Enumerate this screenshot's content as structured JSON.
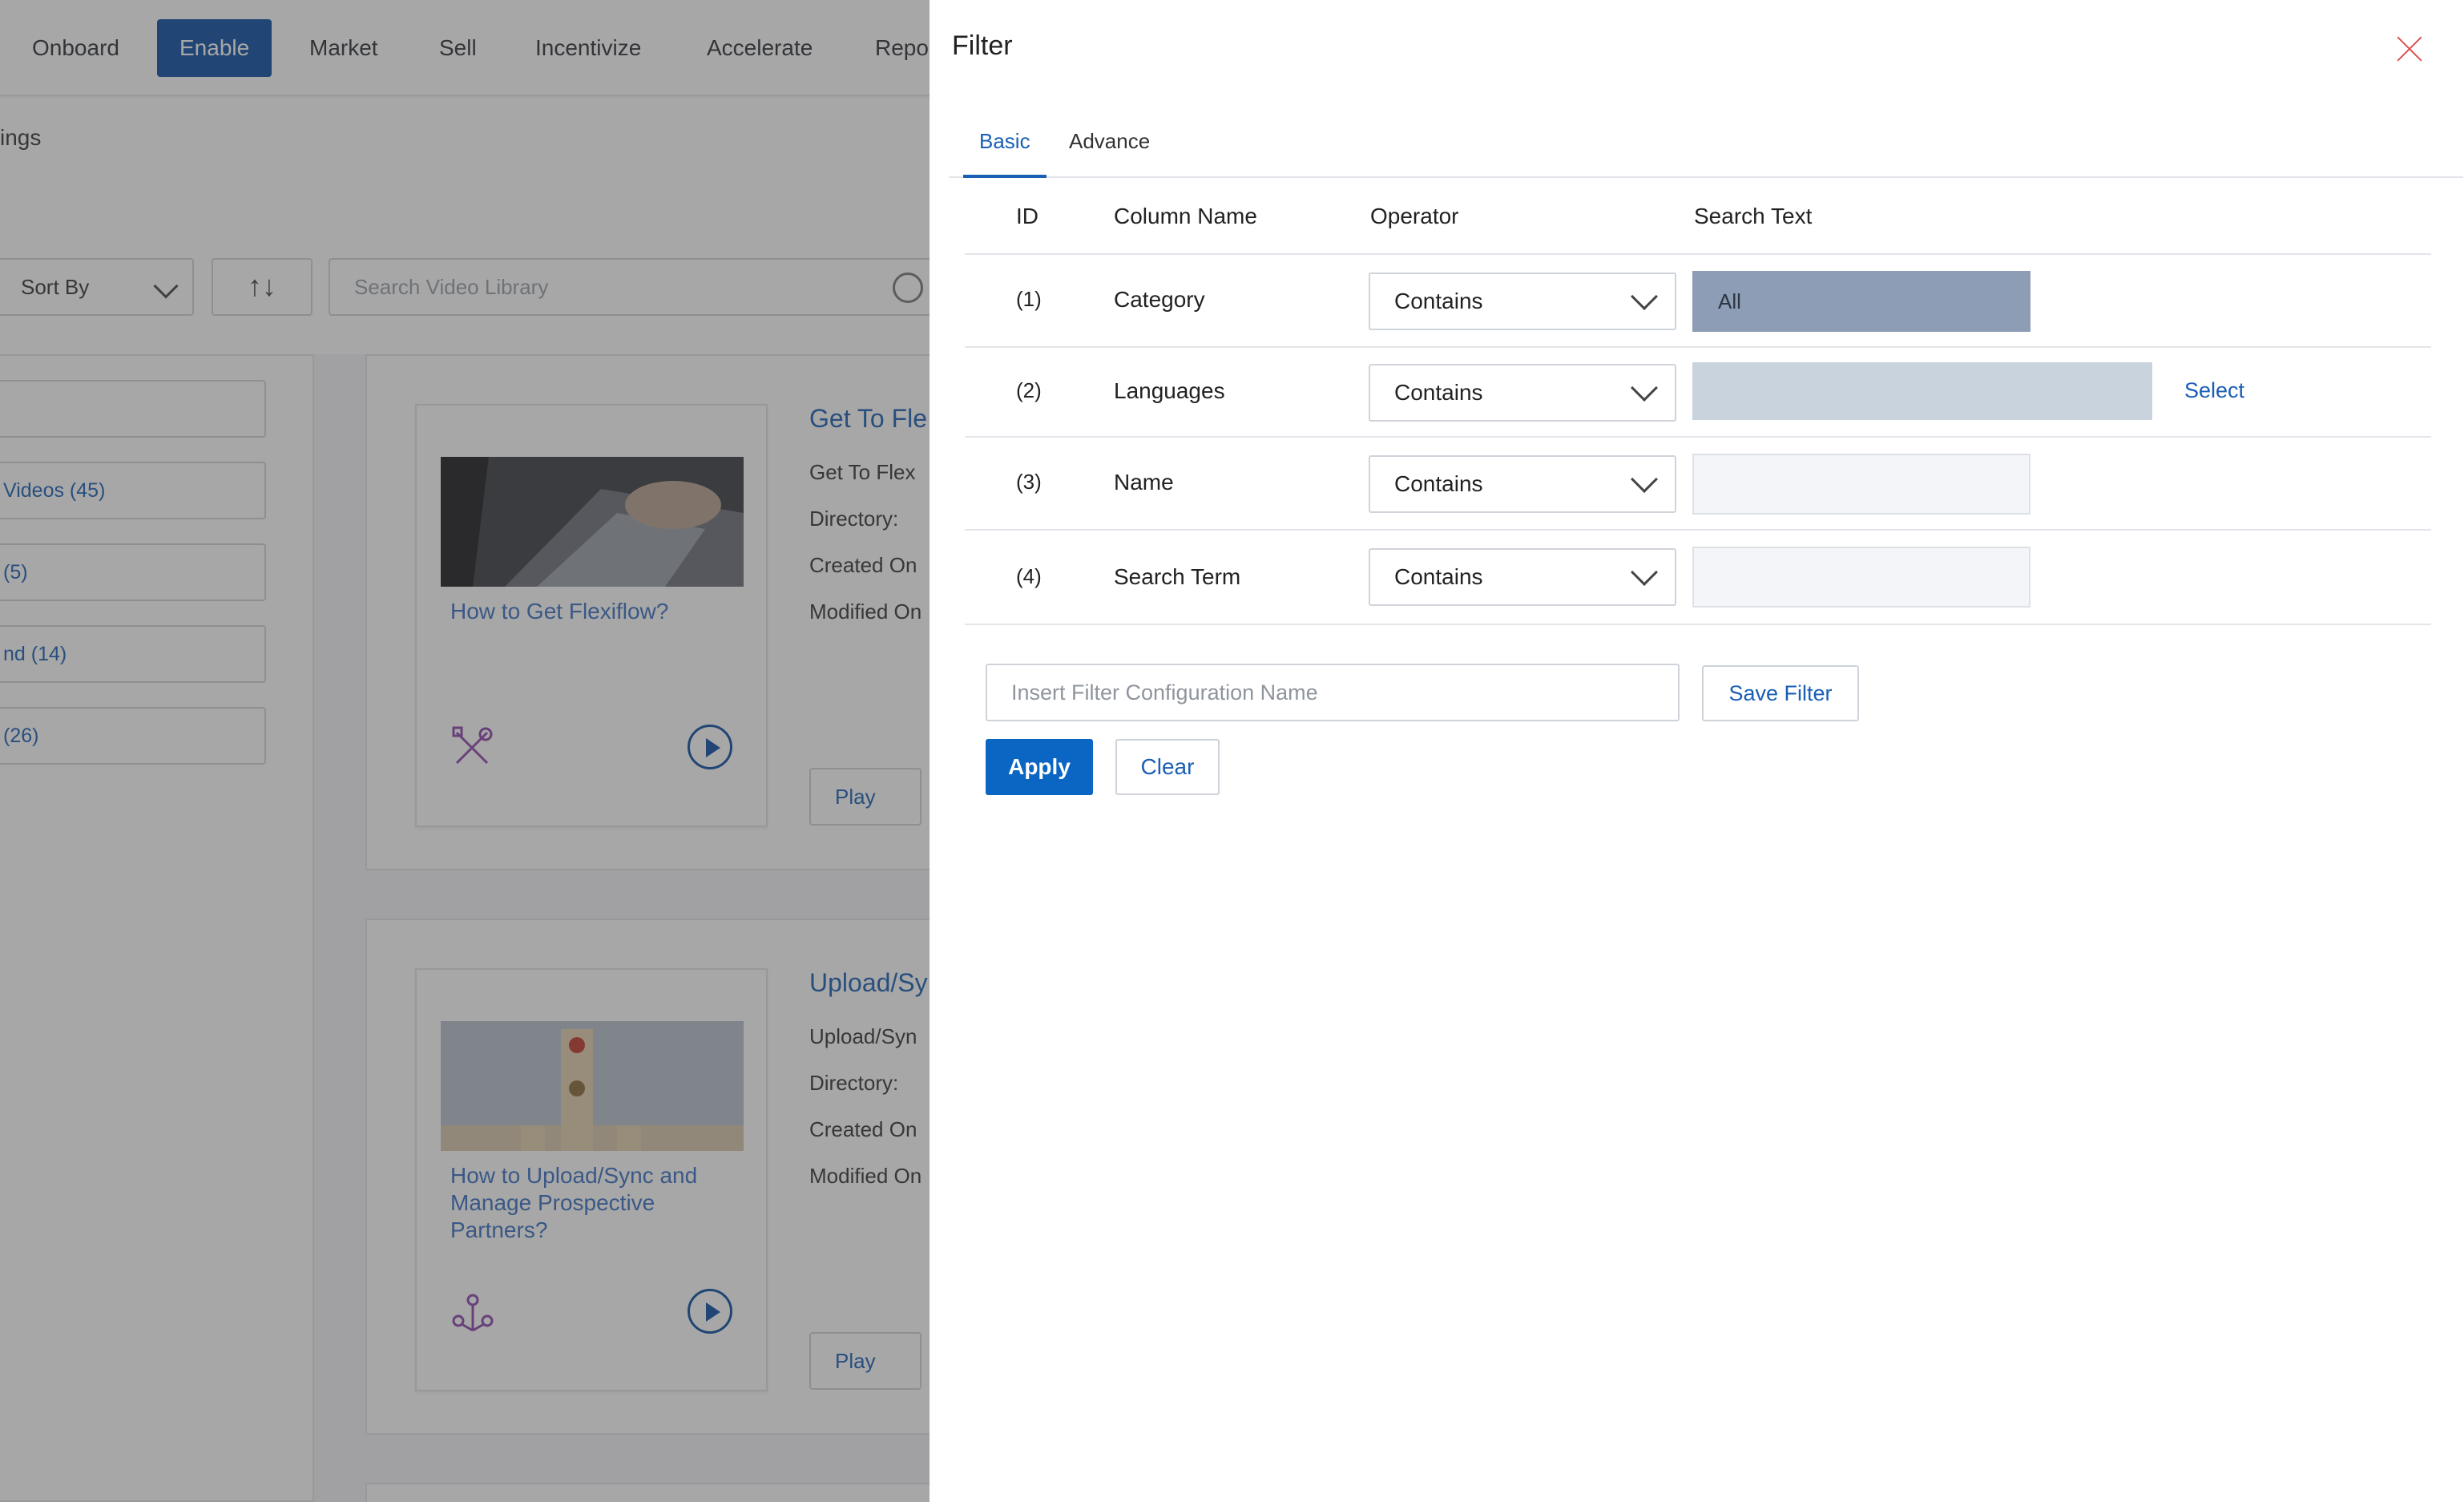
{
  "nav": {
    "items": [
      "Onboard",
      "Enable",
      "Market",
      "Sell",
      "Incentivize",
      "Accelerate",
      "Repo"
    ],
    "active": "Enable"
  },
  "subnav": {
    "label": "ings"
  },
  "toolbar": {
    "sort_label": "Sort By",
    "sort_dir_icon": "↑↓",
    "search_placeholder": "Search Video Library"
  },
  "categories": [
    {
      "label": "Videos (45)"
    },
    {
      "label": "(5)"
    },
    {
      "label": "nd (14)"
    },
    {
      "label": "(26)"
    }
  ],
  "cards": [
    {
      "thumb_title": "How to Get Flexiflow?",
      "detail_title": "Get To Fle",
      "lines": [
        "Get To Flex",
        "Directory:",
        "Created On",
        "Modified On"
      ],
      "play_label": "Play"
    },
    {
      "thumb_title": "How to Upload/Sync and Manage Prospective Partners?",
      "detail_title": "Upload/Sy",
      "lines": [
        "Upload/Syn",
        "Directory:",
        "Created On",
        "Modified On"
      ],
      "play_label": "Play"
    }
  ],
  "filter": {
    "title": "Filter",
    "tabs": [
      "Basic",
      "Advance"
    ],
    "active_tab": "Basic",
    "columns": [
      "ID",
      "Column Name",
      "Operator",
      "Search Text"
    ],
    "rows": [
      {
        "id": "(1)",
        "column": "Category",
        "operator": "Contains",
        "search": "All"
      },
      {
        "id": "(2)",
        "column": "Languages",
        "operator": "Contains",
        "search": "",
        "action": "Select"
      },
      {
        "id": "(3)",
        "column": "Name",
        "operator": "Contains",
        "search": ""
      },
      {
        "id": "(4)",
        "column": "Search Term",
        "operator": "Contains",
        "search": ""
      }
    ],
    "config_placeholder": "Insert Filter Configuration Name",
    "save_label": "Save Filter",
    "apply_label": "Apply",
    "clear_label": "Clear"
  },
  "colors": {
    "primary": "#0b4ea2",
    "link": "#1a5fb4",
    "apply": "#0b66c3",
    "close": "#d9534f",
    "selected_fill": "#8d9db5"
  }
}
